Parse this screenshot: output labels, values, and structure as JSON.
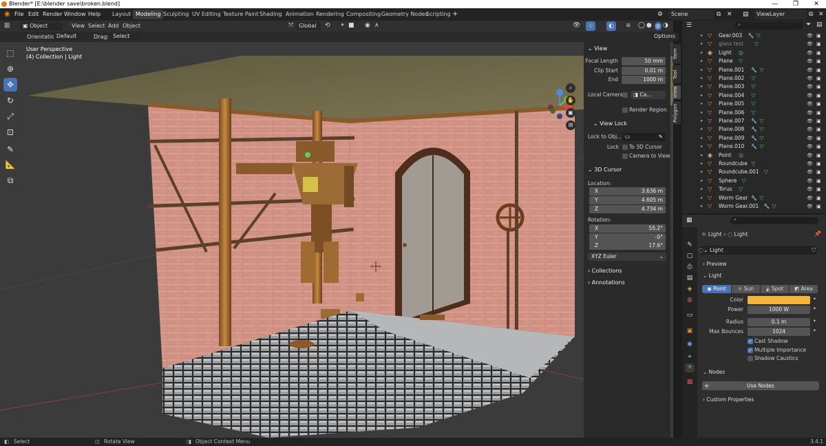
{
  "window": {
    "title": "Blender* [E:\\blender save\\broken.blend]",
    "minimize": "—",
    "maximize": "❐",
    "close": "✕"
  },
  "menu": {
    "items": [
      "File",
      "Edit",
      "Render",
      "Window",
      "Help"
    ]
  },
  "workspaces": [
    "Layout",
    "Modeling",
    "Sculpting",
    "UV Editing",
    "Texture Paint",
    "Shading",
    "Animation",
    "Rendering",
    "Compositing",
    "Geometry Nodes",
    "Scripting"
  ],
  "workspace_add": "+",
  "active_workspace": "Modeling",
  "scene": {
    "name": "Scene",
    "view_layer": "ViewLayer"
  },
  "header": {
    "mode": "Object Mode",
    "menus": [
      "View",
      "Select",
      "Add",
      "Object"
    ],
    "transform_orientation": "Global",
    "options": "Options"
  },
  "tool_options": {
    "orientation_label": "Orientation:",
    "orientation_value": "Default",
    "drag_label": "Drag:",
    "drag_value": "Select Box"
  },
  "viewport": {
    "perspective": "User Perspective",
    "context": "(4) Collection | Light"
  },
  "n_panel": {
    "view_title": "View",
    "focal_length_label": "Focal Length",
    "focal_length": "50 mm",
    "clip_start_label": "Clip Start",
    "clip_start": "0.01 m",
    "end_label": "End",
    "clip_end": "1000 m",
    "local_camera_label": "Local Camera",
    "local_camera_value": "Ca...",
    "render_region": "Render Region",
    "view_lock_title": "View Lock",
    "lock_to_object_label": "Lock to Obj...",
    "lock_label": "Lock",
    "to_3d_cursor": "To 3D Cursor",
    "camera_to_view": "Camera to View",
    "cursor_title": "3D Cursor",
    "location_label": "Location:",
    "loc": {
      "x": "3.636 m",
      "y": "4.605 m",
      "z": "4.734 m"
    },
    "rotation_label": "Rotation:",
    "rot": {
      "x": "55.2°",
      "y": "-0°",
      "z": "17.6°"
    },
    "axis_labels": {
      "x": "X",
      "y": "Y",
      "z": "Z"
    },
    "rotation_mode": "XYZ Euler",
    "collections": "Collections",
    "annotations": "Annotations",
    "tabs": [
      "Item",
      "Tool",
      "View",
      "Polygon"
    ]
  },
  "outliner": {
    "rows": [
      {
        "name": "Gear.003",
        "icon": "mesh",
        "mod": true,
        "mat": true
      },
      {
        "name": "glass test",
        "icon": "mesh",
        "mod": false,
        "mat": true,
        "dim": true
      },
      {
        "name": "Light",
        "icon": "light",
        "mod": false,
        "mat": false
      },
      {
        "name": "Plane",
        "icon": "mesh",
        "mod": false,
        "mat": true
      },
      {
        "name": "Plane.001",
        "icon": "mesh",
        "mod": true,
        "mat": true
      },
      {
        "name": "Plane.002",
        "icon": "mesh",
        "mod": false,
        "mat": true
      },
      {
        "name": "Plane.003",
        "icon": "mesh",
        "mod": false,
        "mat": true
      },
      {
        "name": "Plane.004",
        "icon": "mesh",
        "mod": false,
        "mat": true
      },
      {
        "name": "Plane.005",
        "icon": "mesh",
        "mod": false,
        "mat": true
      },
      {
        "name": "Plane.006",
        "icon": "mesh",
        "mod": false,
        "mat": true
      },
      {
        "name": "Plane.007",
        "icon": "mesh",
        "mod": true,
        "mat": true
      },
      {
        "name": "Plane.008",
        "icon": "mesh",
        "mod": true,
        "mat": true
      },
      {
        "name": "Plane.009",
        "icon": "mesh",
        "mod": true,
        "mat": true
      },
      {
        "name": "Plane.010",
        "icon": "mesh",
        "mod": true,
        "mat": true
      },
      {
        "name": "Point",
        "icon": "light",
        "mod": false,
        "mat": false
      },
      {
        "name": "Roundcube",
        "icon": "mesh",
        "mod": false,
        "mat": true
      },
      {
        "name": "Roundcube.001",
        "icon": "mesh",
        "mod": false,
        "mat": true
      },
      {
        "name": "Sphere",
        "icon": "mesh",
        "mod": false,
        "mat": true
      },
      {
        "name": "Torus",
        "icon": "mesh",
        "mod": false,
        "mat": true
      },
      {
        "name": "Worm Gear",
        "icon": "mesh",
        "mod": true,
        "mat": true
      },
      {
        "name": "Worm Gear.001",
        "icon": "mesh",
        "mod": true,
        "mat": true
      }
    ]
  },
  "properties": {
    "object_name": "Light",
    "data_name": "Light",
    "datablock": "Light",
    "preview": "Preview",
    "light_panel": "Light",
    "light_types": [
      "Point",
      "Sun",
      "Spot",
      "Area"
    ],
    "active_type": "Point",
    "color_label": "Color",
    "color_value": "#f4b53c",
    "power_label": "Power",
    "power": "1000 W",
    "radius_label": "Radius",
    "radius": "0.1 m",
    "max_bounces_label": "Max Bounces",
    "max_bounces": "1024",
    "cast_shadow": "Cast Shadow",
    "multiple_importance": "Multiple Importance",
    "shadow_caustics": "Shadow Caustics",
    "nodes": "Nodes",
    "use_nodes": "Use Nodes",
    "custom_properties": "Custom Properties"
  },
  "status": {
    "select": "Select",
    "rotate": "Rotate View",
    "context_menu": "Object Context Menu",
    "version": "3.4.1"
  },
  "colors": {
    "accent": "#4772b3",
    "light_color": "#f4b53c"
  }
}
